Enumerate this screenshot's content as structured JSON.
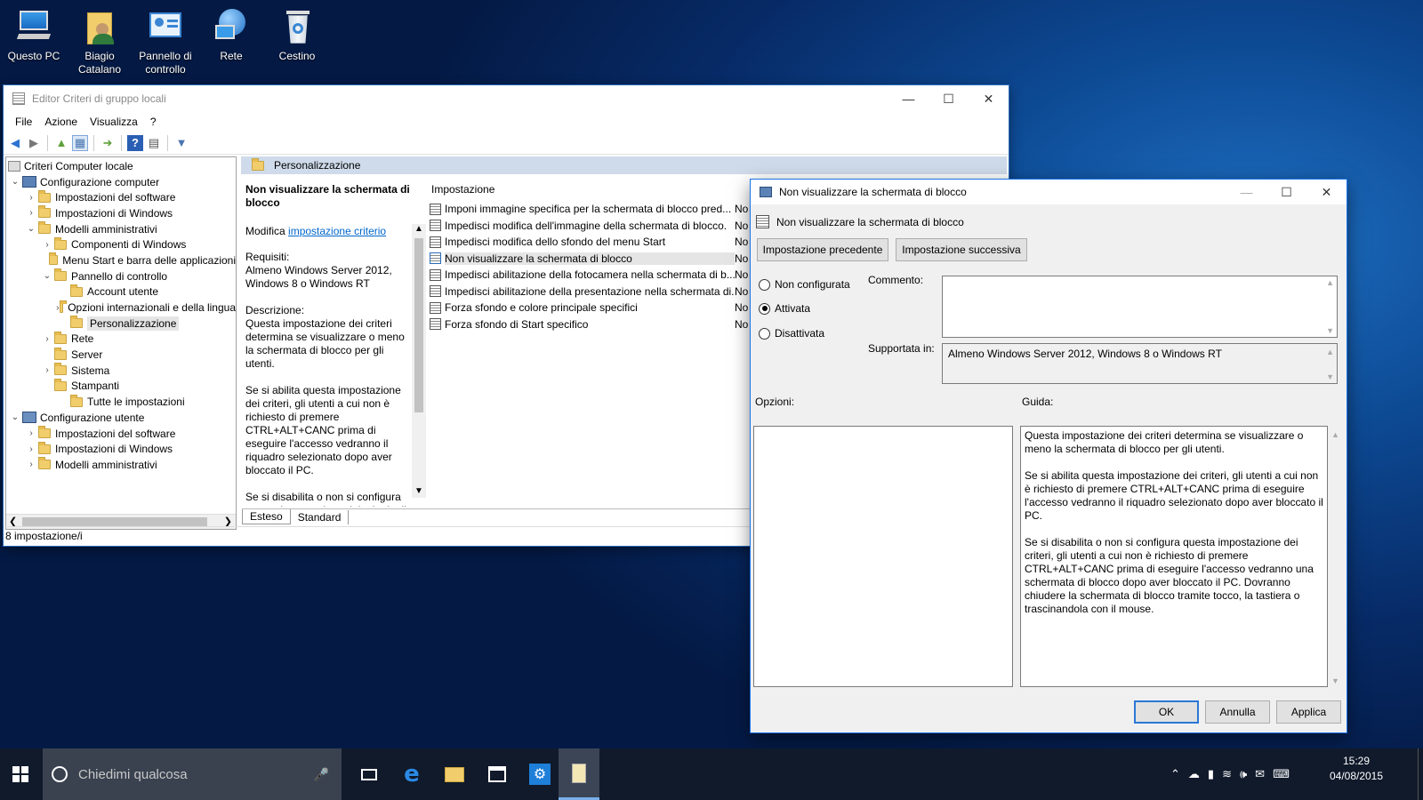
{
  "desktop": {
    "icons": [
      {
        "label": "Questo PC"
      },
      {
        "label": "Biagio Catalano"
      },
      {
        "label": "Pannello di controllo"
      },
      {
        "label": "Rete"
      },
      {
        "label": "Cestino"
      }
    ]
  },
  "main_window": {
    "title": "Editor Criteri di gruppo locali",
    "menu": [
      "File",
      "Azione",
      "Visualizza",
      "?"
    ],
    "tree": [
      {
        "label": "Criteri Computer locale"
      },
      {
        "label": "Configurazione computer"
      },
      {
        "label": "Impostazioni del software"
      },
      {
        "label": "Impostazioni di Windows"
      },
      {
        "label": "Modelli amministrativi"
      },
      {
        "label": "Componenti di Windows"
      },
      {
        "label": "Menu Start e barra delle applicazioni"
      },
      {
        "label": "Pannello di controllo"
      },
      {
        "label": "Account utente"
      },
      {
        "label": "Opzioni internazionali e della lingua"
      },
      {
        "label": "Personalizzazione"
      },
      {
        "label": "Rete"
      },
      {
        "label": "Server"
      },
      {
        "label": "Sistema"
      },
      {
        "label": "Stampanti"
      },
      {
        "label": "Tutte le impostazioni"
      },
      {
        "label": "Configurazione utente"
      },
      {
        "label": "Impostazioni del software"
      },
      {
        "label": "Impostazioni di Windows"
      },
      {
        "label": "Modelli amministrativi"
      }
    ],
    "header": "Personalizzazione",
    "extended": {
      "title": "Non visualizzare la schermata di blocco",
      "edit_prefix": "Modifica ",
      "edit_link": "impostazione criterio",
      "requirements_label": "Requisiti:",
      "requirements": "Almeno Windows Server 2012, Windows 8 o Windows RT",
      "description_label": "Descrizione:",
      "p1": "Questa impostazione dei criteri determina se visualizzare o meno la schermata di blocco per gli utenti.",
      "p2": "Se si abilita questa impostazione dei criteri, gli utenti a cui non è richiesto di premere CTRL+ALT+CANC prima di eseguire l'accesso vedranno il riquadro selezionato dopo aver bloccato il PC.",
      "p3": "Se si disabilita o non si configura questa impostazione dei criteri, gli"
    },
    "list_header": "Impostazione",
    "policies": [
      {
        "name": "Imponi immagine specifica per la schermata di blocco pred...",
        "state": "No"
      },
      {
        "name": "Impedisci modifica dell'immagine della schermata di blocco.",
        "state": "No"
      },
      {
        "name": "Impedisci modifica dello sfondo del menu Start",
        "state": "No"
      },
      {
        "name": "Non visualizzare la schermata di blocco",
        "state": "No"
      },
      {
        "name": "Impedisci abilitazione della fotocamera nella schermata di b...",
        "state": "No"
      },
      {
        "name": "Impedisci abilitazione della presentazione nella schermata di...",
        "state": "No"
      },
      {
        "name": "Forza sfondo e colore principale specifici",
        "state": "No"
      },
      {
        "name": "Forza sfondo di Start specifico",
        "state": "No"
      }
    ],
    "tabs": [
      "Esteso",
      "Standard"
    ],
    "status": "8 impostazione/i"
  },
  "dialog": {
    "title": "Non visualizzare la schermata di blocco",
    "subtitle": "Non visualizzare la schermata di blocco",
    "prev": "Impostazione precedente",
    "next": "Impostazione successiva",
    "radios": [
      "Non configurata",
      "Attivata",
      "Disattivata"
    ],
    "comment_label": "Commento:",
    "supported_label": "Supportata in:",
    "supported_value": "Almeno Windows Server 2012, Windows 8 o Windows RT",
    "options_label": "Opzioni:",
    "help_label": "Guida:",
    "help_p1": "Questa impostazione dei criteri determina se visualizzare o meno la schermata di blocco per gli utenti.",
    "help_p2": "Se si abilita questa impostazione dei criteri, gli utenti a cui non è richiesto di premere CTRL+ALT+CANC prima di eseguire l'accesso vedranno il riquadro selezionato dopo aver bloccato il PC.",
    "help_p3": "Se si disabilita o non si configura questa impostazione dei criteri, gli utenti a cui non è richiesto di premere CTRL+ALT+CANC prima di eseguire l'accesso vedranno una schermata di blocco dopo aver bloccato il PC. Dovranno chiudere la schermata di blocco tramite tocco, la tastiera o trascinandola con il mouse.",
    "ok": "OK",
    "cancel": "Annulla",
    "apply": "Applica"
  },
  "taskbar": {
    "search_placeholder": "Chiedimi qualcosa",
    "time": "15:29",
    "date": "04/08/2015"
  }
}
